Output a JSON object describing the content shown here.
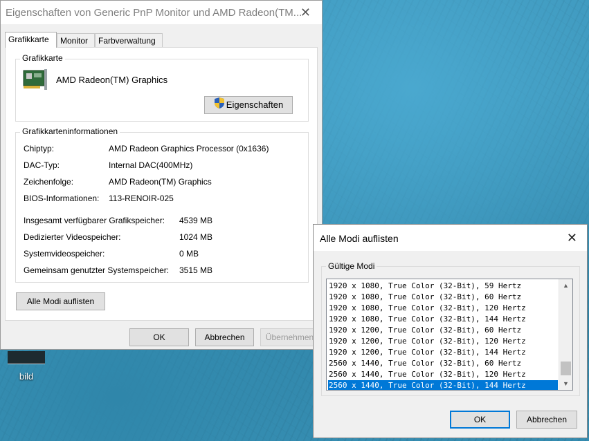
{
  "desktop": {
    "icon_label": "bild"
  },
  "main_window": {
    "title": "Eigenschaften von Generic PnP Monitor und AMD Radeon(TM...",
    "tabs": [
      {
        "label": "Grafikkarte",
        "active": true
      },
      {
        "label": "Monitor",
        "active": false
      },
      {
        "label": "Farbverwaltung",
        "active": false
      }
    ],
    "adapter_group": {
      "title": "Grafikkarte",
      "adapter_name": "AMD Radeon(TM) Graphics",
      "properties_button": "Eigenschaften"
    },
    "info_group": {
      "title": "Grafikkarteninformationen",
      "rows": [
        {
          "label": "Chiptyp:",
          "value": "AMD Radeon Graphics Processor (0x1636)"
        },
        {
          "label": "DAC-Typ:",
          "value": "Internal DAC(400MHz)"
        },
        {
          "label": "Zeichenfolge:",
          "value": "AMD Radeon(TM) Graphics"
        },
        {
          "label": "BIOS-Informationen:",
          "value": "113-RENOIR-025"
        }
      ],
      "memory_rows": [
        {
          "label": "Insgesamt verfügbarer Grafikspeicher:",
          "value": "4539 MB"
        },
        {
          "label": "Dedizierter Videospeicher:",
          "value": "1024 MB"
        },
        {
          "label": "Systemvideospeicher:",
          "value": "0 MB"
        },
        {
          "label": "Gemeinsam genutzter Systemspeicher:",
          "value": "3515 MB"
        }
      ]
    },
    "list_modes_button": "Alle Modi auflisten",
    "ok_button": "OK",
    "cancel_button": "Abbrechen",
    "apply_button": "Übernehmen"
  },
  "modes_dialog": {
    "title": "Alle Modi auflisten",
    "group_title": "Gültige Modi",
    "modes": [
      "1920 x 1080, True Color (32-Bit), 59 Hertz",
      "1920 x 1080, True Color (32-Bit), 60 Hertz",
      "1920 x 1080, True Color (32-Bit), 120 Hertz",
      "1920 x 1080, True Color (32-Bit), 144 Hertz",
      "1920 x 1200, True Color (32-Bit), 60 Hertz",
      "1920 x 1200, True Color (32-Bit), 120 Hertz",
      "1920 x 1200, True Color (32-Bit), 144 Hertz",
      "2560 x 1440, True Color (32-Bit), 60 Hertz",
      "2560 x 1440, True Color (32-Bit), 120 Hertz",
      "2560 x 1440, True Color (32-Bit), 144 Hertz"
    ],
    "selected_index": 9,
    "ok_button": "OK",
    "cancel_button": "Abbrechen"
  },
  "colors": {
    "accent": "#0078d7",
    "window_bg": "#f0f0f0"
  }
}
